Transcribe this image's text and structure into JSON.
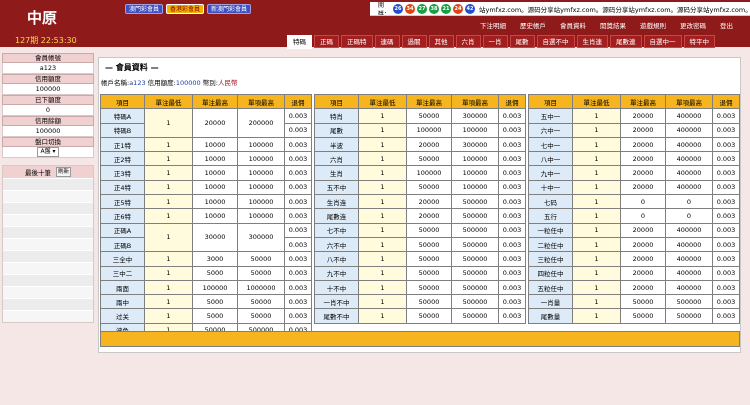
{
  "header": {
    "logo": "中原",
    "period": "127期 22:53:30",
    "market_tabs": [
      {
        "label": "澳門彩會員",
        "active": false
      },
      {
        "label": "香港彩會員",
        "active": true
      },
      {
        "label": "新澳門彩會員",
        "active": false
      }
    ],
    "lottery_label": "開獎：",
    "balls": [
      {
        "num": "26",
        "color": "blue"
      },
      {
        "num": "34",
        "color": "red"
      },
      {
        "num": "27",
        "color": "green"
      },
      {
        "num": "38",
        "color": "green"
      },
      {
        "num": "21",
        "color": "green"
      },
      {
        "num": "24",
        "color": "red"
      },
      {
        "num": "42",
        "color": "blue"
      }
    ],
    "marquee": "站ymfxz.com。源码分享站ymfxz.com。源码分享站ymfxz.com。源码分享站ymfxz.com。源码分享站ymfxz.com。",
    "top_links": [
      "下注明細",
      "歷史帳戶",
      "會員資料",
      "開獎結果",
      "遊戲規則",
      "更改密碼",
      "登出"
    ],
    "game_tabs": [
      {
        "label": "特碼",
        "active": true
      },
      {
        "label": "正碼",
        "active": false
      },
      {
        "label": "正碼特",
        "active": false
      },
      {
        "label": "連碼",
        "active": false
      },
      {
        "label": "過關",
        "active": false
      },
      {
        "label": "其他",
        "active": false
      },
      {
        "label": "六肖",
        "active": false
      },
      {
        "label": "一肖",
        "active": false
      },
      {
        "label": "尾數",
        "active": false
      },
      {
        "label": "自選不中",
        "active": false
      },
      {
        "label": "生肖連",
        "active": false
      },
      {
        "label": "尾數連",
        "active": false
      },
      {
        "label": "自選中一",
        "active": false
      },
      {
        "label": "特平中",
        "active": false
      }
    ]
  },
  "sidebar": {
    "account_label": "會員帳號",
    "account": "a123",
    "credit_label": "信用額度",
    "credit": "100000",
    "bet_label": "已下額度",
    "bet": "0",
    "balance_label": "信用餘額",
    "balance": "100000",
    "switch_label": "盤口切換",
    "switch_value": "A盤 ▾",
    "recent_label": "最後十筆",
    "refresh_label": "刷新"
  },
  "main": {
    "title": "— 會員資料 —",
    "acct_label": "帳戶名稱:",
    "acct_value": "a123",
    "credit_label": "信用額度:",
    "credit_value": "100000",
    "currency_label": "幣別:",
    "currency_value": "人民幣",
    "columns": [
      "項目",
      "單注最低",
      "單注最高",
      "單項最高",
      "退佣"
    ]
  },
  "table1": [
    {
      "name": "特碼A",
      "min": "1",
      "max": "20000",
      "item": "200000",
      "rebate": "0.003"
    },
    {
      "name": "特碼B",
      "min": "",
      "max": "",
      "item": "",
      "rebate": "0.003"
    },
    {
      "name": "正1特",
      "min": "1",
      "max": "10000",
      "item": "100000",
      "rebate": "0.003"
    },
    {
      "name": "正2特",
      "min": "1",
      "max": "10000",
      "item": "100000",
      "rebate": "0.003"
    },
    {
      "name": "正3特",
      "min": "1",
      "max": "10000",
      "item": "100000",
      "rebate": "0.003"
    },
    {
      "name": "正4特",
      "min": "1",
      "max": "10000",
      "item": "100000",
      "rebate": "0.003"
    },
    {
      "name": "正5特",
      "min": "1",
      "max": "10000",
      "item": "100000",
      "rebate": "0.003"
    },
    {
      "name": "正6特",
      "min": "1",
      "max": "10000",
      "item": "100000",
      "rebate": "0.003"
    },
    {
      "name": "正碼A",
      "min": "1",
      "max": "30000",
      "item": "300000",
      "rebate": "0.003"
    },
    {
      "name": "正碼B",
      "min": "",
      "max": "",
      "item": "",
      "rebate": "0.003"
    },
    {
      "name": "三全中",
      "min": "1",
      "max": "3000",
      "item": "50000",
      "rebate": "0.003"
    },
    {
      "name": "三中二",
      "min": "1",
      "max": "5000",
      "item": "50000",
      "rebate": "0.003"
    },
    {
      "name": "兩面",
      "min": "1",
      "max": "100000",
      "item": "1000000",
      "rebate": "0.003"
    },
    {
      "name": "兩中",
      "min": "1",
      "max": "5000",
      "item": "50000",
      "rebate": "0.003"
    },
    {
      "name": "过关",
      "min": "1",
      "max": "5000",
      "item": "50000",
      "rebate": "0.003"
    },
    {
      "name": "波色",
      "min": "1",
      "max": "50000",
      "item": "500000",
      "rebate": "0.003"
    }
  ],
  "table2": [
    {
      "name": "特肖",
      "min": "1",
      "max": "50000",
      "item": "300000",
      "rebate": "0.003"
    },
    {
      "name": "尾數",
      "min": "1",
      "max": "100000",
      "item": "100000",
      "rebate": "0.003"
    },
    {
      "name": "半波",
      "min": "1",
      "max": "20000",
      "item": "300000",
      "rebate": "0.003"
    },
    {
      "name": "六肖",
      "min": "1",
      "max": "50000",
      "item": "100000",
      "rebate": "0.003"
    },
    {
      "name": "生肖",
      "min": "1",
      "max": "100000",
      "item": "100000",
      "rebate": "0.003"
    },
    {
      "name": "五不中",
      "min": "1",
      "max": "50000",
      "item": "100000",
      "rebate": "0.003"
    },
    {
      "name": "生肖连",
      "min": "1",
      "max": "20000",
      "item": "500000",
      "rebate": "0.003"
    },
    {
      "name": "尾數连",
      "min": "1",
      "max": "20000",
      "item": "500000",
      "rebate": "0.003"
    },
    {
      "name": "七不中",
      "min": "1",
      "max": "50000",
      "item": "500000",
      "rebate": "0.003"
    },
    {
      "name": "六不中",
      "min": "1",
      "max": "50000",
      "item": "500000",
      "rebate": "0.003"
    },
    {
      "name": "八不中",
      "min": "1",
      "max": "50000",
      "item": "500000",
      "rebate": "0.003"
    },
    {
      "name": "九不中",
      "min": "1",
      "max": "50000",
      "item": "500000",
      "rebate": "0.003"
    },
    {
      "name": "十不中",
      "min": "1",
      "max": "50000",
      "item": "500000",
      "rebate": "0.003"
    },
    {
      "name": "一肖不中",
      "min": "1",
      "max": "50000",
      "item": "500000",
      "rebate": "0.003"
    },
    {
      "name": "尾數不中",
      "min": "1",
      "max": "50000",
      "item": "500000",
      "rebate": "0.003"
    }
  ],
  "table3": [
    {
      "name": "五中一",
      "min": "1",
      "max": "20000",
      "item": "400000",
      "rebate": "0.003"
    },
    {
      "name": "六中一",
      "min": "1",
      "max": "20000",
      "item": "400000",
      "rebate": "0.003"
    },
    {
      "name": "七中一",
      "min": "1",
      "max": "20000",
      "item": "400000",
      "rebate": "0.003"
    },
    {
      "name": "八中一",
      "min": "1",
      "max": "20000",
      "item": "400000",
      "rebate": "0.003"
    },
    {
      "name": "九中一",
      "min": "1",
      "max": "20000",
      "item": "400000",
      "rebate": "0.003"
    },
    {
      "name": "十中一",
      "min": "1",
      "max": "20000",
      "item": "400000",
      "rebate": "0.003"
    },
    {
      "name": "七码",
      "min": "1",
      "max": "0",
      "item": "0",
      "rebate": "0.003"
    },
    {
      "name": "五行",
      "min": "1",
      "max": "0",
      "item": "0",
      "rebate": "0.003"
    },
    {
      "name": "一粒任中",
      "min": "1",
      "max": "20000",
      "item": "400000",
      "rebate": "0.003"
    },
    {
      "name": "二粒任中",
      "min": "1",
      "max": "20000",
      "item": "400000",
      "rebate": "0.003"
    },
    {
      "name": "三粒任中",
      "min": "1",
      "max": "20000",
      "item": "400000",
      "rebate": "0.003"
    },
    {
      "name": "四粒任中",
      "min": "1",
      "max": "20000",
      "item": "400000",
      "rebate": "0.003"
    },
    {
      "name": "五粒任中",
      "min": "1",
      "max": "20000",
      "item": "400000",
      "rebate": "0.003"
    },
    {
      "name": "一肖量",
      "min": "1",
      "max": "50000",
      "item": "500000",
      "rebate": "0.003"
    },
    {
      "name": "尾數量",
      "min": "1",
      "max": "50000",
      "item": "500000",
      "rebate": "0.003"
    }
  ],
  "colors": {
    "header": "#8e1a1a",
    "table_header": "#f6b51e",
    "name_cell": "#ddebf8",
    "active_tab": "#ffffff"
  }
}
